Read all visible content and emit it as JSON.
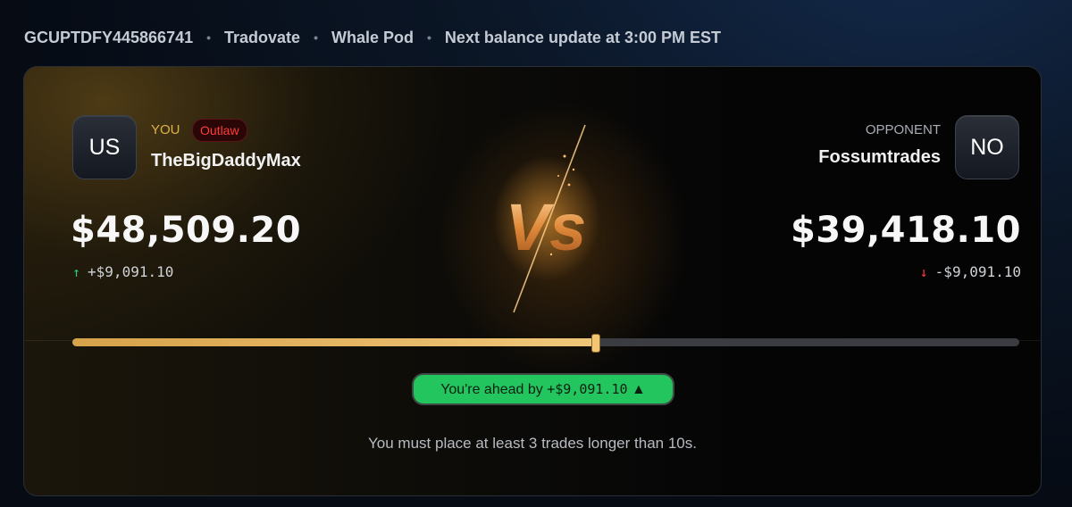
{
  "header": {
    "account_id": "GCUPTDFY445866741",
    "platform": "Tradovate",
    "pod": "Whale Pod",
    "next_update": "Next balance update at 3:00 PM EST",
    "separator": "•"
  },
  "you": {
    "avatar_initials": "US",
    "role_label": "YOU",
    "badge": "Outlaw",
    "name": "TheBigDaddyMax",
    "balance": "$48,509.20",
    "change": "+$9,091.10",
    "change_icon": "arrow-up-icon",
    "change_color": "#2ecc71"
  },
  "opponent": {
    "avatar_initials": "NO",
    "role_label": "OPPONENT",
    "name": "Fossumtrades",
    "balance": "$39,418.10",
    "change": "-$9,091.10",
    "change_icon": "arrow-down-icon",
    "change_color": "#ff3b3b"
  },
  "versus": {
    "label": "Vs"
  },
  "progress": {
    "you_share": 0.552
  },
  "status": {
    "text": "You're ahead by",
    "amount": "+$9,091.10",
    "icon": "triangle-up-icon",
    "color": "#22c55e"
  },
  "note": "You must place at least 3 trades longer than 10s.",
  "colors": {
    "accent_gold": "#d6a24a",
    "badge_red": "#ff3b3b"
  }
}
